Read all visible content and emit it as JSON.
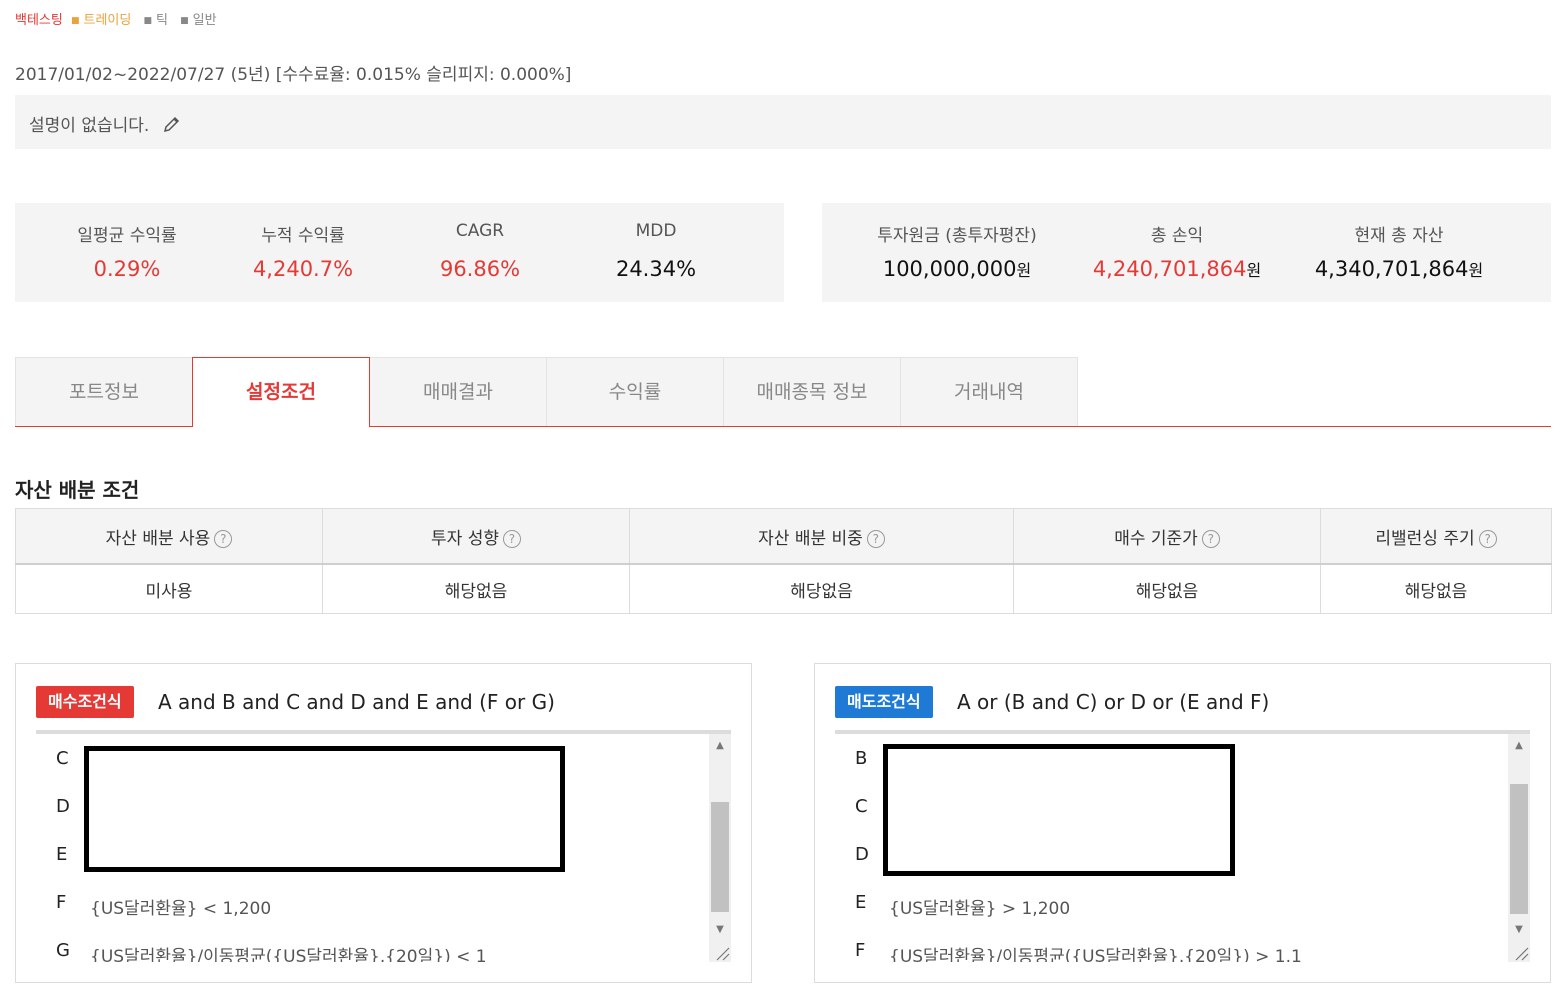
{
  "tags": {
    "backtesting": "백테스팅",
    "trading": "트레이딩",
    "tick": "틱",
    "general": "일반"
  },
  "period_text": "2017/01/02~2022/07/27 (5년) [수수료율: 0.015% 슬리피지: 0.000%]",
  "description": "설명이 없습니다.",
  "stats_left": [
    {
      "label": "일평균 수익률",
      "value": "0.29%"
    },
    {
      "label": "누적 수익률",
      "value": "4,240.7%"
    },
    {
      "label": "CAGR",
      "value": "96.86%"
    },
    {
      "label": "MDD",
      "value": "24.34%"
    }
  ],
  "stats_right": [
    {
      "label": "투자원금 (총투자평잔)",
      "value": "100,000,000",
      "unit": "원"
    },
    {
      "label": "총 손익",
      "value": "4,240,701,864",
      "unit": "원"
    },
    {
      "label": "현재 총 자산",
      "value": "4,340,701,864",
      "unit": "원"
    }
  ],
  "tabs": [
    "포트정보",
    "설정조건",
    "매매결과",
    "수익률",
    "매매종목 정보",
    "거래내역"
  ],
  "active_tab": "설정조건",
  "allocation": {
    "title": "자산 배분 조건",
    "headers": [
      "자산 배분 사용",
      "투자 성향",
      "자산 배분 비중",
      "매수 기준가",
      "리밸런싱 주기"
    ],
    "values": [
      "미사용",
      "해당없음",
      "해당없음",
      "해당없음",
      "해당없음"
    ],
    "help_glyph": "?"
  },
  "buy": {
    "badge": "매수조건식",
    "formula": "A and B and C and D and E and (F or G)",
    "rows": [
      {
        "letter": "C",
        "text": ""
      },
      {
        "letter": "D",
        "text": ""
      },
      {
        "letter": "E",
        "text": ""
      },
      {
        "letter": "F",
        "text": "{US달러환율} < 1,200"
      },
      {
        "letter": "G",
        "text": "{US달러환율}/이동평균({US달러환율},{20일}) < 1"
      }
    ]
  },
  "sell": {
    "badge": "매도조건식",
    "formula": "A or (B and C) or D or (E and F)",
    "rows": [
      {
        "letter": "B",
        "text": ""
      },
      {
        "letter": "C",
        "text": ""
      },
      {
        "letter": "D",
        "text": ""
      },
      {
        "letter": "E",
        "text": "{US달러환율} > 1,200"
      },
      {
        "letter": "F",
        "text": "{US달러환율}/이동평균({US달러환율},{20일}) > 1.1"
      }
    ]
  },
  "colors": {
    "accent_red": "#e53935",
    "accent_blue": "#1f7ad6",
    "trading_orange": "#e8a33c"
  }
}
